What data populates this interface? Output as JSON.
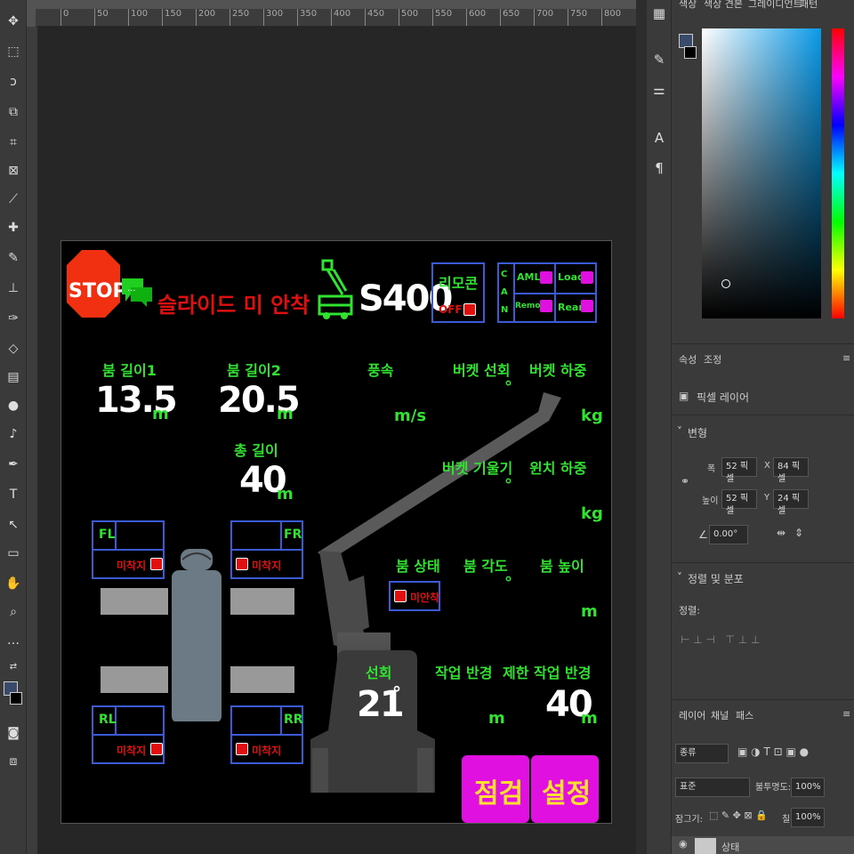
{
  "ruler": {
    "ticks": [
      "0",
      "50",
      "100",
      "150",
      "200",
      "250",
      "300",
      "350",
      "400",
      "450",
      "500",
      "550",
      "600",
      "650",
      "700",
      "750",
      "800"
    ]
  },
  "hmi": {
    "stop": "STOP",
    "warning": "슬라이드 미 안착",
    "model": "S400",
    "remote": {
      "title": "리모콘",
      "state": "OFF"
    },
    "can": {
      "letters": "C A N",
      "aml": "AML",
      "load": "Load",
      "remote": "Remote",
      "rear": "Rear"
    },
    "boom1": {
      "label": "붐 길이1",
      "value": "13.5",
      "unit": "m"
    },
    "boom2": {
      "label": "붐 길이2",
      "value": "20.5",
      "unit": "m"
    },
    "total": {
      "label": "총 길이",
      "value": "40",
      "unit": "m"
    },
    "wind": {
      "label": "풍속",
      "unit": "m/s"
    },
    "bucket_rot": {
      "label": "버켓 선회",
      "unit": "°"
    },
    "bucket_load": {
      "label": "버켓 하중",
      "unit": "kg"
    },
    "bucket_tilt": {
      "label": "버켓 기울기",
      "unit": "°"
    },
    "winch_load": {
      "label": "윈치 하중",
      "unit": "kg"
    },
    "boom_state": {
      "label": "붐 상태",
      "value": "미안착"
    },
    "boom_angle": {
      "label": "붐 각도",
      "unit": "°"
    },
    "boom_height": {
      "label": "붐 높이",
      "unit": "m"
    },
    "slew": {
      "label": "선회",
      "value": "21",
      "unit": "°"
    },
    "work_radius": {
      "label": "작업 반경",
      "unit": "m"
    },
    "limit_radius": {
      "label": "제한 작업 반경",
      "value": "40",
      "unit": "m"
    },
    "outriggers": {
      "fl": {
        "label": "FL",
        "status": "미착지"
      },
      "fr": {
        "label": "FR",
        "status": "미착지"
      },
      "rl": {
        "label": "RL",
        "status": "미착지"
      },
      "rr": {
        "label": "RR",
        "status": "미착지"
      }
    },
    "buttons": {
      "inspect": "점검",
      "settings": "설정"
    }
  },
  "panels": {
    "top_tabs": [
      "색상",
      "색상 견본",
      "그레이디언트",
      "패턴"
    ],
    "props_tabs": [
      "속성",
      "조정"
    ],
    "pixel_layer": "픽셀 레이어",
    "transform": {
      "title": "변형",
      "w_label": "폭",
      "w": "52 픽셀",
      "x_label": "X",
      "x": "84 픽셀",
      "h_label": "높이",
      "h": "52 픽셀",
      "y_label": "Y",
      "y": "24 픽셀",
      "angle": "0.00°"
    },
    "align": {
      "title": "정렬 및 분포",
      "sub": "정렬:"
    },
    "layers_tabs": [
      "레이어",
      "채널",
      "패스"
    ],
    "kind": "종류",
    "blend": "표준",
    "opacity_label": "불투명도:",
    "opacity": "100%",
    "lock_label": "잠그기:",
    "fill_label": "칠:",
    "fill": "100%",
    "layer_name": "상태"
  },
  "colors": {
    "green": "#31e231",
    "red": "#e01010",
    "magenta": "#e010e0",
    "blue": "#3a5ad8"
  }
}
